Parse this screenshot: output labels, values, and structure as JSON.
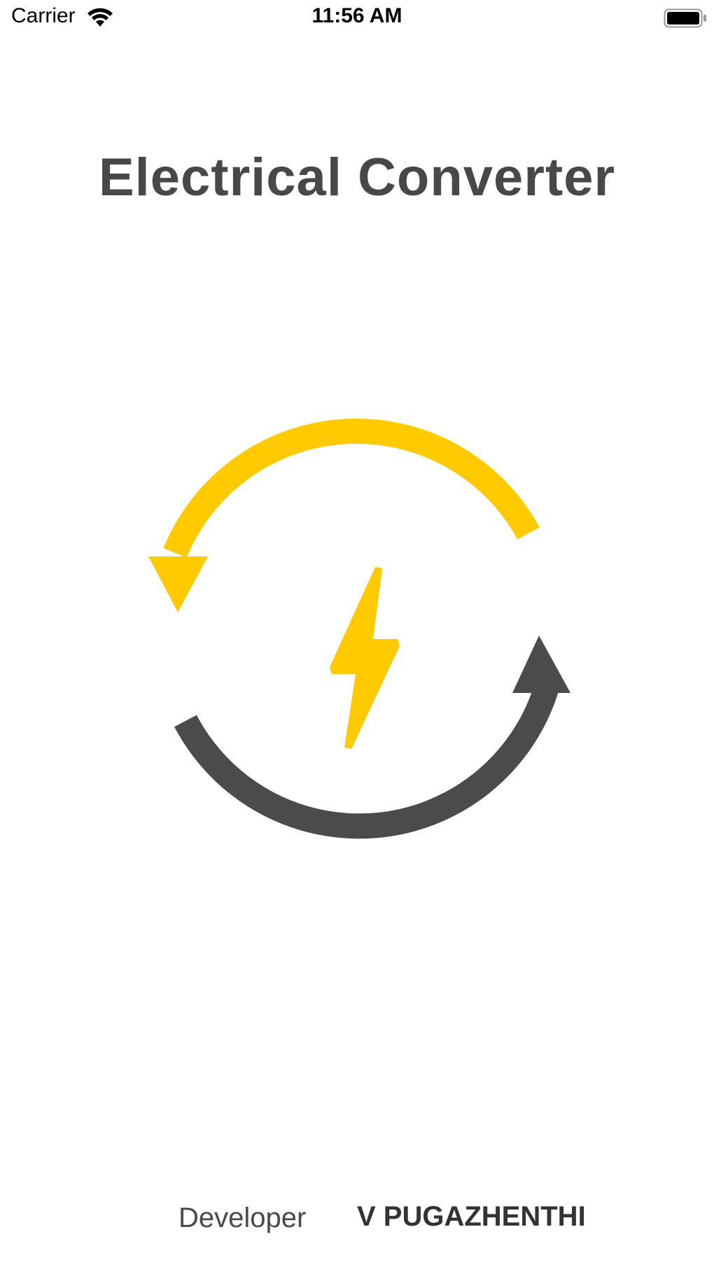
{
  "status_bar": {
    "carrier": "Carrier",
    "time": "11:56 AM",
    "wifi_icon": "wifi-icon",
    "battery_icon": "battery-icon"
  },
  "app": {
    "title": "Electrical Converter",
    "logo_icon": "electrical-convert-cycle-icon",
    "colors": {
      "accent": "#FFCB00",
      "dark": "#4B4B4B",
      "title": "#484848"
    }
  },
  "footer": {
    "developer_label": "Developer",
    "developer_name": "V PUGAZHENTHI"
  }
}
